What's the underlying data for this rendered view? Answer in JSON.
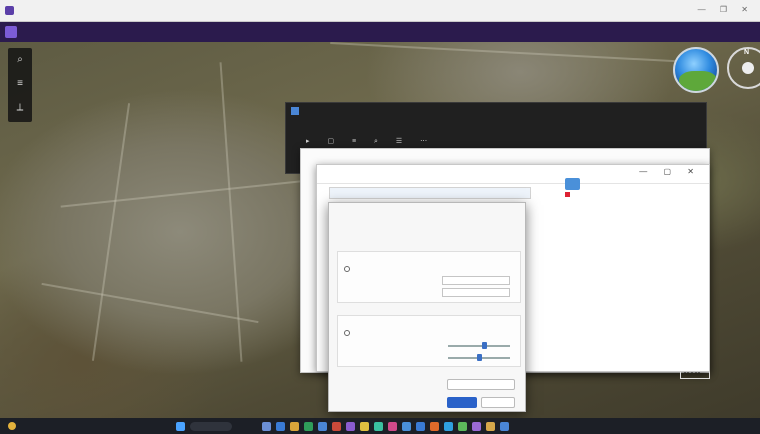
{
  "browser": {
    "tab_title": "",
    "window_controls": "— ❐ ✕"
  },
  "app": {
    "title": ""
  },
  "map": {
    "labels": [
      "",
      "",
      ""
    ],
    "tools": [
      "search-icon",
      "layers-icon",
      "ruler-icon"
    ]
  },
  "back_window": {
    "title": "",
    "toolbar": "▸ ▢ ≡ ⌕ ☰ ⋯"
  },
  "explorer": {
    "title": "",
    "search_hint": "",
    "controls": "— ▢ ✕",
    "file_labels": [
      "",
      "",
      ""
    ]
  },
  "dialog": {
    "title": "",
    "description": "",
    "section1": {
      "label": "",
      "rows": [
        "",
        "",
        ""
      ]
    },
    "section2": {
      "label": "",
      "rows": [
        "",
        "",
        ""
      ]
    },
    "sliders": [
      0.6,
      0.5
    ],
    "buttons": {
      "link": "",
      "secondary": "",
      "ok": "",
      "cancel": ""
    }
  },
  "taskbar": {
    "search_placeholder": "",
    "tray": ""
  },
  "colors": {
    "app_header": "#2b1b4d",
    "dialog_primary": "#2a62c9",
    "taskbar": "#1c1f26"
  }
}
